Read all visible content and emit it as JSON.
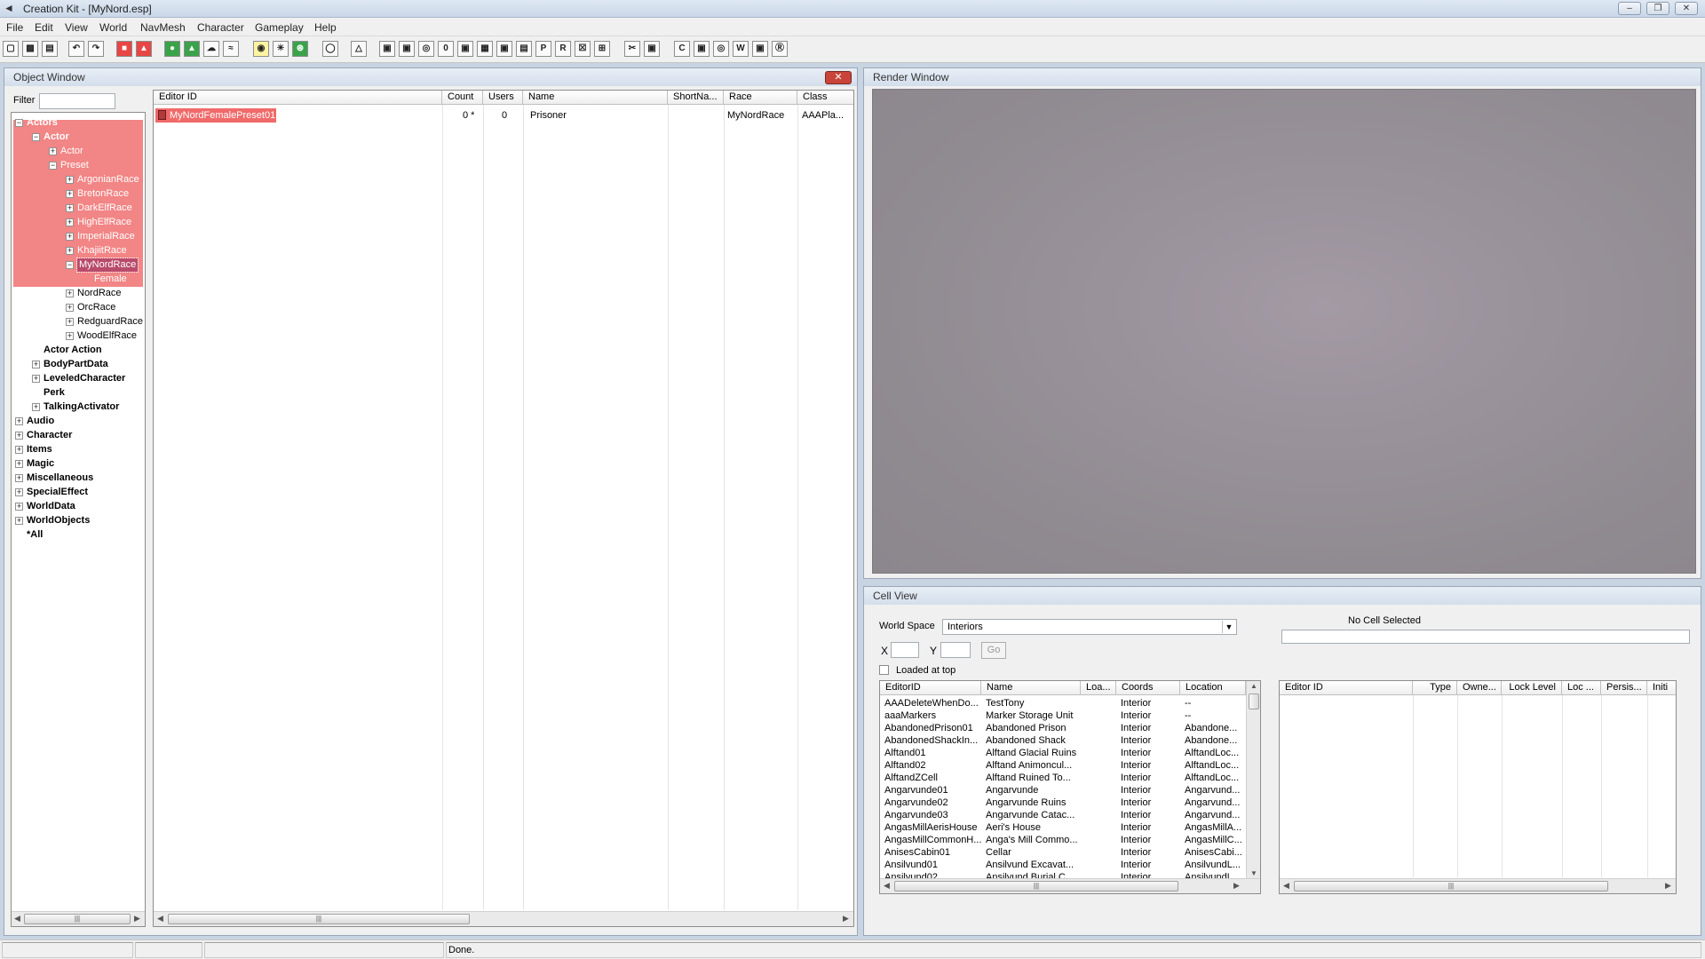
{
  "window": {
    "title": "Creation Kit - [MyNord.esp]"
  },
  "menu": [
    "File",
    "Edit",
    "View",
    "World",
    "NavMesh",
    "Character",
    "Gameplay",
    "Help"
  ],
  "toolbar": {
    "icons": [
      "open-icon",
      "save-icon",
      "preferences-icon",
      "undo-icon",
      "redo-icon",
      "collision-icon",
      "markers-icon",
      "lights-icon",
      "landscape-icon",
      "sky-icon",
      "water-icon",
      "bulb-icon",
      "sky-icon",
      "grass-icon",
      "dialogue-icon",
      "navmesh-icon",
      "cube-icon",
      "cube2-icon",
      "cube3-icon",
      "cube4-icon",
      "cube5-icon",
      "cube6-icon",
      "cube7-icon",
      "cube8-icon",
      "cube9-icon",
      "cube10-icon",
      "cube11-icon",
      "cube12-icon",
      "cube13-icon",
      "cube14-icon",
      "cube15-icon",
      "cube16-icon",
      "cube17-icon",
      "cube18-icon"
    ]
  },
  "object_window": {
    "title": "Object Window",
    "filter_label": "Filter",
    "filter_value": "",
    "tree": [
      {
        "label": "Actors",
        "bold": true,
        "indent": 0,
        "expander": "minus",
        "hl": true
      },
      {
        "label": "Actor",
        "bold": true,
        "indent": 1,
        "expander": "minus",
        "hl": true
      },
      {
        "label": "Actor",
        "bold": false,
        "indent": 2,
        "expander": "plus",
        "hl": true
      },
      {
        "label": "Preset",
        "bold": false,
        "indent": 2,
        "expander": "minus",
        "hl": true
      },
      {
        "label": "ArgonianRace",
        "bold": false,
        "indent": 3,
        "expander": "plus",
        "hl": true
      },
      {
        "label": "BretonRace",
        "bold": false,
        "indent": 3,
        "expander": "plus",
        "hl": true
      },
      {
        "label": "DarkElfRace",
        "bold": false,
        "indent": 3,
        "expander": "plus",
        "hl": true
      },
      {
        "label": "HighElfRace",
        "bold": false,
        "indent": 3,
        "expander": "plus",
        "hl": true
      },
      {
        "label": "ImperialRace",
        "bold": false,
        "indent": 3,
        "expander": "plus",
        "hl": true
      },
      {
        "label": "KhajiitRace",
        "bold": false,
        "indent": 3,
        "expander": "plus",
        "hl": true
      },
      {
        "label": "MyNordRace",
        "bold": false,
        "indent": 3,
        "expander": "minus",
        "hl": true,
        "selected": true
      },
      {
        "label": "Female",
        "bold": false,
        "indent": 4,
        "expander": "none",
        "hl": true
      },
      {
        "label": "NordRace",
        "bold": false,
        "indent": 3,
        "expander": "plus"
      },
      {
        "label": "OrcRace",
        "bold": false,
        "indent": 3,
        "expander": "plus"
      },
      {
        "label": "RedguardRace",
        "bold": false,
        "indent": 3,
        "expander": "plus"
      },
      {
        "label": "WoodElfRace",
        "bold": false,
        "indent": 3,
        "expander": "plus"
      },
      {
        "label": "Actor Action",
        "bold": true,
        "indent": 1,
        "expander": "none"
      },
      {
        "label": "BodyPartData",
        "bold": true,
        "indent": 1,
        "expander": "plus"
      },
      {
        "label": "LeveledCharacter",
        "bold": true,
        "indent": 1,
        "expander": "plus"
      },
      {
        "label": "Perk",
        "bold": true,
        "indent": 1,
        "expander": "none"
      },
      {
        "label": "TalkingActivator",
        "bold": true,
        "indent": 1,
        "expander": "plus"
      },
      {
        "label": "Audio",
        "bold": true,
        "indent": 0,
        "expander": "plus"
      },
      {
        "label": "Character",
        "bold": true,
        "indent": 0,
        "expander": "plus"
      },
      {
        "label": "Items",
        "bold": true,
        "indent": 0,
        "expander": "plus"
      },
      {
        "label": "Magic",
        "bold": true,
        "indent": 0,
        "expander": "plus"
      },
      {
        "label": "Miscellaneous",
        "bold": true,
        "indent": 0,
        "expander": "plus"
      },
      {
        "label": "SpecialEffect",
        "bold": true,
        "indent": 0,
        "expander": "plus"
      },
      {
        "label": "WorldData",
        "bold": true,
        "indent": 0,
        "expander": "plus"
      },
      {
        "label": "WorldObjects",
        "bold": true,
        "indent": 0,
        "expander": "plus"
      },
      {
        "label": "*All",
        "bold": true,
        "indent": 0,
        "expander": "none"
      }
    ],
    "columns": [
      "Editor ID",
      "Count",
      "Users",
      "Name",
      "ShortNa...",
      "Race",
      "Class"
    ],
    "rows": [
      {
        "editor_id": "MyNordFemalePreset01",
        "count": "0 *",
        "users": "0",
        "name": "Prisoner",
        "short_name": "",
        "race": "MyNordRace",
        "class": "AAAPla..."
      }
    ]
  },
  "render_window": {
    "title": "Render Window"
  },
  "cell_view": {
    "title": "Cell View",
    "world_space_label": "World Space",
    "world_space_value": "Interiors",
    "x_label": "X",
    "y_label": "Y",
    "go_label": "Go",
    "loaded_at_top_label": "Loaded at top",
    "no_cell_label": "No Cell Selected",
    "columns": [
      "EditorID",
      "Name",
      "Loa...",
      "Coords",
      "Location"
    ],
    "rows": [
      [
        "AAADeleteWhenDo...",
        "TestTony",
        "",
        "Interior",
        "--"
      ],
      [
        "aaaMarkers",
        "Marker Storage Unit",
        "",
        "Interior",
        "--"
      ],
      [
        "AbandonedPrison01",
        "Abandoned Prison",
        "",
        "Interior",
        "Abandone..."
      ],
      [
        "AbandonedShackIn...",
        "Abandoned Shack",
        "",
        "Interior",
        "Abandone..."
      ],
      [
        "Alftand01",
        "Alftand Glacial Ruins",
        "",
        "Interior",
        "AlftandLoc..."
      ],
      [
        "Alftand02",
        "Alftand Animoncul...",
        "",
        "Interior",
        "AlftandLoc..."
      ],
      [
        "AlftandZCell",
        "Alftand Ruined To...",
        "",
        "Interior",
        "AlftandLoc..."
      ],
      [
        "Angarvunde01",
        "Angarvunde",
        "",
        "Interior",
        "Angarvund..."
      ],
      [
        "Angarvunde02",
        "Angarvunde Ruins",
        "",
        "Interior",
        "Angarvund..."
      ],
      [
        "Angarvunde03",
        "Angarvunde Catac...",
        "",
        "Interior",
        "Angarvund..."
      ],
      [
        "AngasMillAerisHouse",
        "Aeri's House",
        "",
        "Interior",
        "AngasMillA..."
      ],
      [
        "AngasMillCommonH...",
        "Anga's Mill Commo...",
        "",
        "Interior",
        "AngasMillC..."
      ],
      [
        "AnisesCabin01",
        "Cellar",
        "",
        "Interior",
        "AnisesCabi..."
      ],
      [
        "Ansilvund01",
        "Ansilvund Excavat...",
        "",
        "Interior",
        "AnsilvundL..."
      ],
      [
        "Ansilvund02",
        "Ansilvund Burial C...",
        "",
        "Interior",
        "AnsilvundL..."
      ]
    ],
    "ref_columns": [
      "Editor ID",
      "Type",
      "Owne...",
      "Lock Level",
      "Loc ...",
      "Persis...",
      "Initi"
    ]
  },
  "status": {
    "text": "Done."
  }
}
